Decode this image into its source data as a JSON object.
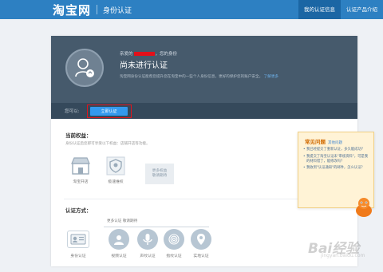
{
  "header": {
    "logo": "淘宝网",
    "title": "身份认证",
    "nav": [
      "我的认证信息",
      "认证产品介绍"
    ]
  },
  "hero": {
    "greeting_prefix": "亲爱的",
    "greeting_suffix": "，您的身份",
    "status": "尚未进行认证",
    "desc": "淘宝网身份认证能帮您提升您在淘宝中的一些个人身份信息，更好的保护您的账户安全。",
    "desc_link": "了解更多"
  },
  "action": {
    "label": "您可以:",
    "button": "立即认证"
  },
  "privileges": {
    "title": "当前权益：",
    "subtitle": "身份认证后您即可享受以下权益：店铺开店等功能。",
    "items": [
      {
        "label": "淘宝开店",
        "icon": "shop-icon"
      },
      {
        "label": "极速维权",
        "icon": "shield-icon"
      }
    ],
    "more": "更多权益\n敬请期待"
  },
  "methods": {
    "title": "认证方式：",
    "more_label": "更多认证 敬请期待",
    "items": [
      {
        "label": "身份认证",
        "icon": "id-card-icon"
      },
      {
        "label": "视频认证",
        "icon": "video-icon"
      },
      {
        "label": "声纹认证",
        "icon": "microphone-icon"
      },
      {
        "label": "指纹认证",
        "icon": "fingerprint-icon"
      },
      {
        "label": "实地认证",
        "icon": "location-icon"
      }
    ]
  },
  "faq": {
    "title": "常见问题",
    "more": "其他问题",
    "items": [
      "我已经提交了重新认证，多久能成功？",
      "我提交了淘宝认证未\"审核资料\"，可是我的材料错了，能修改吗？",
      "我收到\"认证通知\"的邮件，怎么认证？"
    ]
  },
  "watermark": {
    "text": "Bai经验",
    "sub": "jingyan.baidu.com"
  },
  "colors": {
    "header": "#2d80c2",
    "hero": "#465a6c",
    "button": "#3399ee",
    "highlight": "#e0141c"
  }
}
